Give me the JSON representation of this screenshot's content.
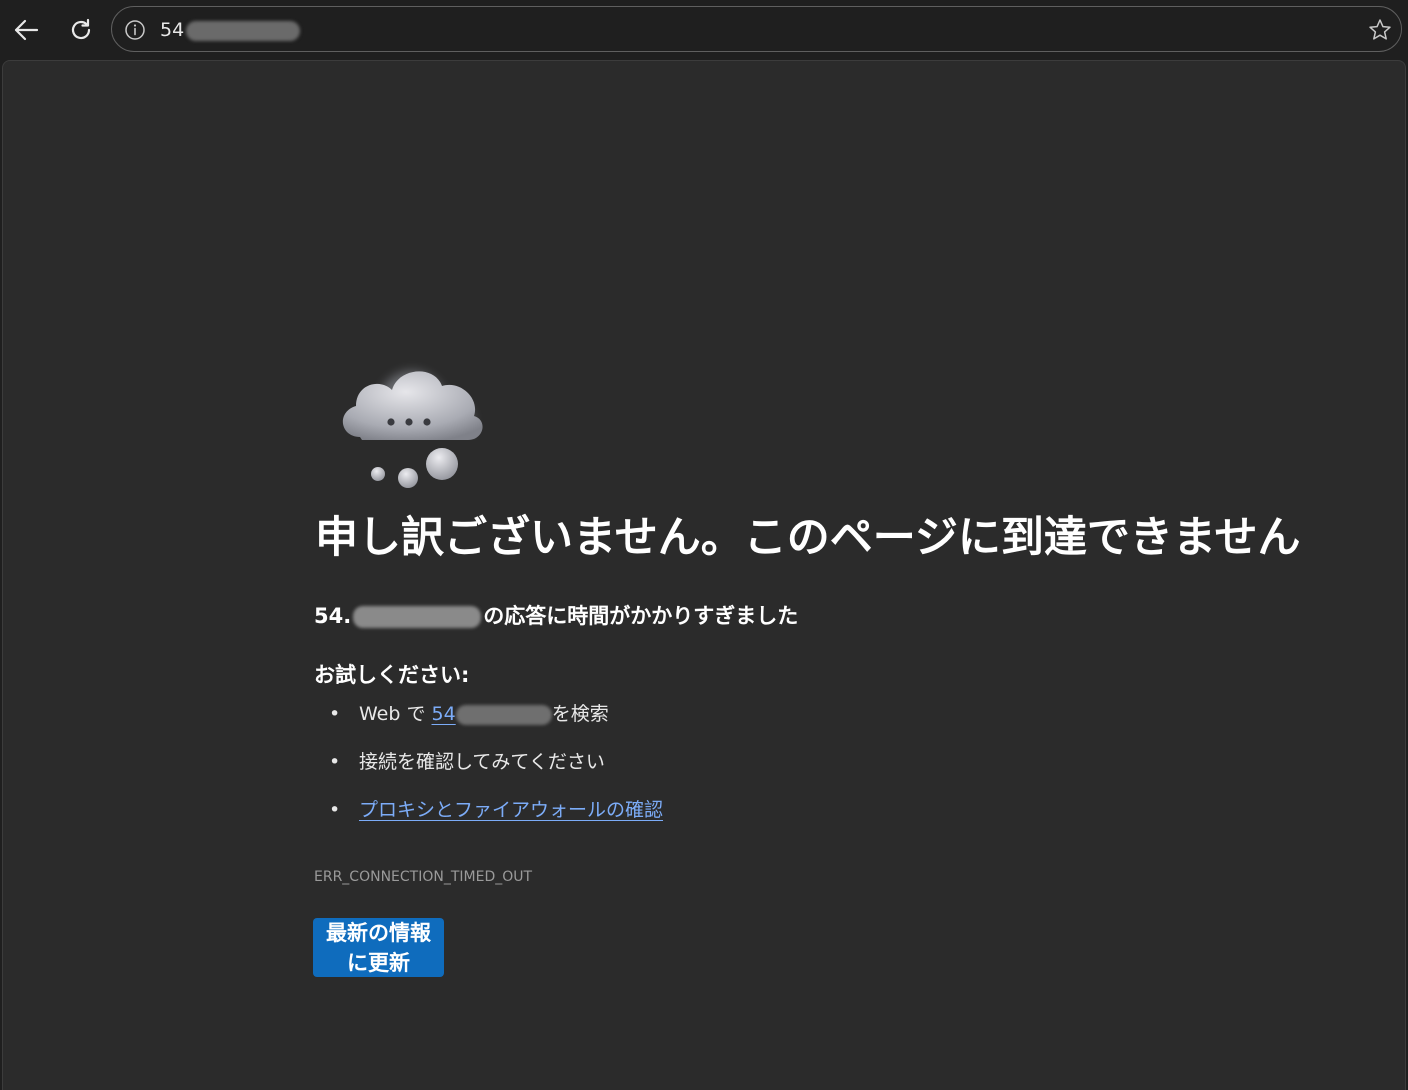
{
  "browser": {
    "url_prefix": "54",
    "back_icon": "arrow-left-icon",
    "reload_icon": "reload-icon",
    "info_icon": "info-icon",
    "favorite_icon": "star-icon"
  },
  "error_page": {
    "illustration": "thinking-cloud-icon",
    "title": "申し訳ございません。このページに到達できません",
    "subtitle_prefix": "54.",
    "subtitle_suffix": "の応答に時間がかかりすぎました",
    "try_heading": "お試しください:",
    "suggestions": {
      "search_prefix": "Web で ",
      "search_link_prefix": "54",
      "search_suffix": "を検索",
      "check_connection": "接続を確認してみてください",
      "proxy_firewall_link": "プロキシとファイアウォールの確認"
    },
    "error_code": "ERR_CONNECTION_TIMED_OUT",
    "refresh_button": {
      "line1": "最新の情報",
      "line2": "に更新"
    }
  },
  "colors": {
    "page_background": "#2b2b2b",
    "toolbar_background": "#1f1f1f",
    "link": "#7cacf8",
    "button": "#0f6cbd"
  }
}
